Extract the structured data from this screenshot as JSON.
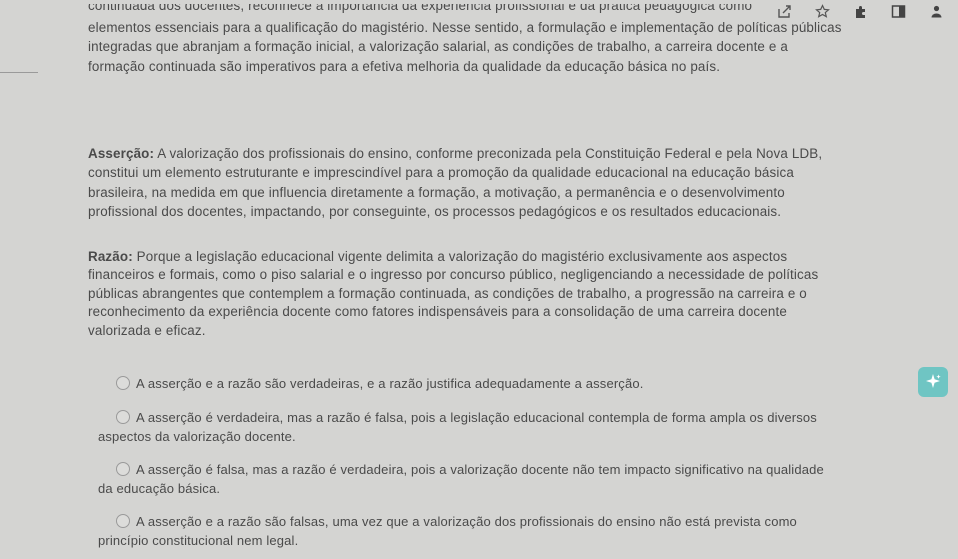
{
  "toolbar": {
    "icons": [
      "share-icon",
      "star-icon",
      "extension-icon",
      "sidebar-icon",
      "profile-icon"
    ]
  },
  "passage": {
    "intro_line1": "continuada dos docentes, reconhece a importância da experiência profissional e da prática pedagógica como",
    "intro_rest": "elementos essenciais para a qualificação do magistério. Nesse sentido, a formulação e implementação de políticas públicas integradas que abranjam a formação inicial, a valorização salarial, as condições de trabalho, a carreira docente e a formação continuada são imperativos para a efetiva melhoria da qualidade da educação básica no país.",
    "assertion_label": "Asserção:",
    "assertion_text": " A valorização dos profissionais do ensino, conforme preconizada pela Constituição Federal e pela Nova LDB, constitui um elemento estruturante e imprescindível para a promoção da qualidade educacional na educação básica brasileira, na medida em que influencia diretamente a formação, a motivação, a permanência e o desenvolvimento profissional dos docentes, impactando, por conseguinte, os processos pedagógicos e os resultados educacionais.",
    "reason_label": "Razão:",
    "reason_text": " Porque a legislação educacional vigente delimita a valorização do magistério exclusivamente aos aspectos financeiros e formais, como o piso salarial e o ingresso por concurso público, negligenciando a necessidade de políticas públicas abrangentes que contemplem a formação continuada, as condições de trabalho, a progressão na carreira e o reconhecimento da experiência docente como fatores indispensáveis para a consolidação de uma carreira docente valorizada e eficaz."
  },
  "options": [
    "A asserção e a razão são verdadeiras, e a razão justifica adequadamente a asserção.",
    "A asserção é verdadeira, mas a razão é falsa, pois a legislação educacional contempla de forma ampla os diversos aspectos da valorização docente.",
    "A asserção é falsa, mas a razão é verdadeira, pois a valorização docente não tem impacto significativo na qualidade da educação básica.",
    "A asserção e a razão são falsas, uma vez que a valorização dos profissionais do ensino não está prevista como princípio constitucional nem legal."
  ],
  "colors": {
    "background": "#d4d4d2",
    "text": "#4a4a4a",
    "fab": "#6fc5c3"
  }
}
